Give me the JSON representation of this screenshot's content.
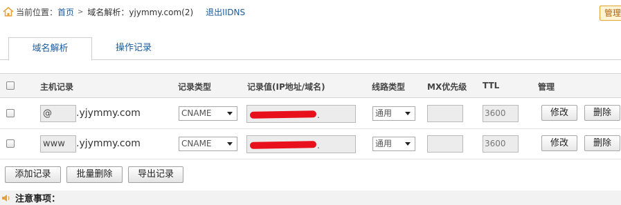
{
  "breadcrumb": {
    "prefix": "当前位置：",
    "home": "首页",
    "separator": ">",
    "current": "域名解析：yjymmy.com(2)",
    "logout": "退出IIDNS"
  },
  "top_right_button": "管理",
  "tabs": [
    {
      "label": "域名解析",
      "active": true
    },
    {
      "label": "操作记录",
      "active": false
    }
  ],
  "table": {
    "headers": {
      "host": "主机记录",
      "type": "记录类型",
      "value": "记录值(IP地址/域名)",
      "line": "线路类型",
      "mx": "MX优先级",
      "ttl": "TTL",
      "manage": "管理"
    },
    "rows": [
      {
        "host": "@",
        "suffix": ".yjymmy.com",
        "type": "CNAME",
        "value_redacted_tail": ".",
        "line": "通用",
        "mx": "",
        "ttl": "3600",
        "edit": "修改",
        "delete": "删除"
      },
      {
        "host": "www",
        "suffix": ".yjymmy.com",
        "type": "CNAME",
        "value_redacted_tail": ".",
        "line": "通用",
        "mx": "",
        "ttl": "3600",
        "edit": "修改",
        "delete": "删除"
      }
    ]
  },
  "actions": {
    "add": "添加记录",
    "batch_delete": "批量删除",
    "export": "导出记录"
  },
  "notice": {
    "title": "注意事项："
  },
  "colors": {
    "link": "#1a5a9c",
    "redaction": "#e8101a",
    "manage_border": "#e3a32f"
  }
}
